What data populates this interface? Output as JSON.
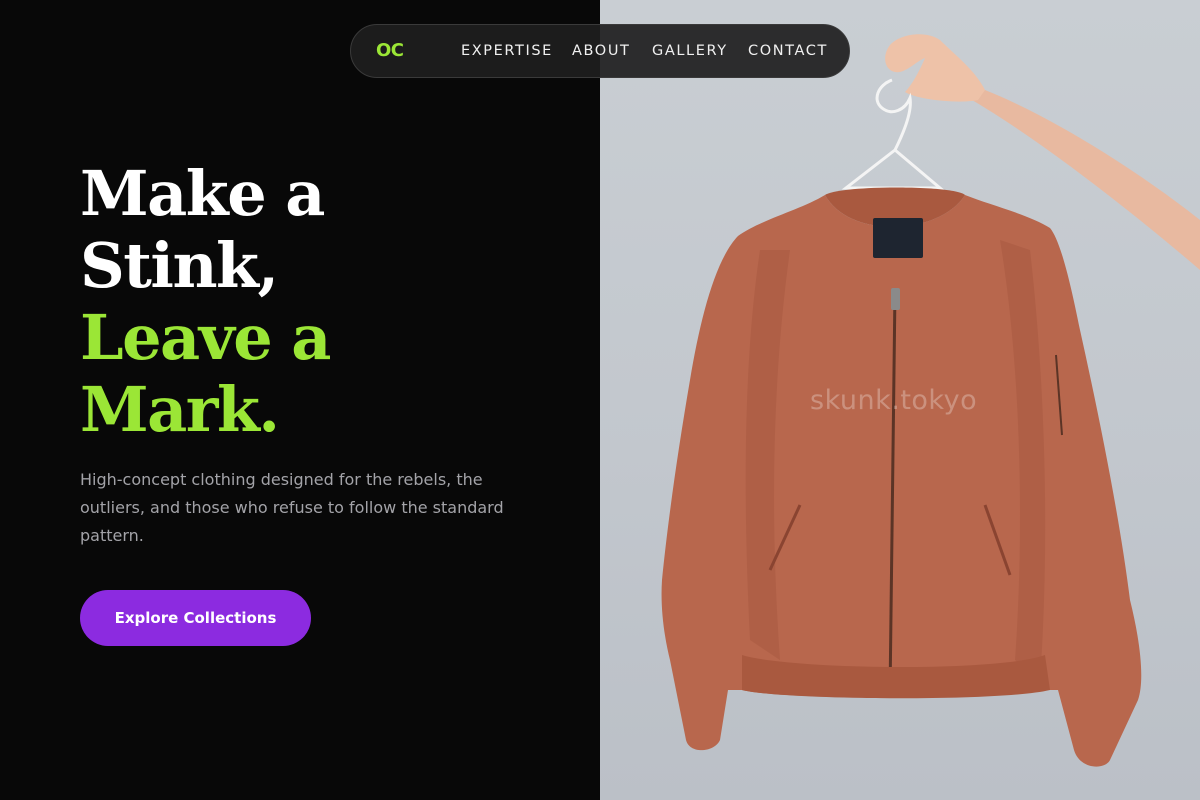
{
  "brand": {
    "logo": "OC",
    "accent_color": "#9be636"
  },
  "nav": {
    "items": [
      {
        "label": "EXPERTISE"
      },
      {
        "label": "ABOUT"
      },
      {
        "label": "GALLERY"
      },
      {
        "label": "CONTACT"
      }
    ]
  },
  "hero": {
    "headline": {
      "line1": "Make a",
      "line2": "Stink,",
      "line3": "Leave a",
      "line4": "Mark."
    },
    "subtitle": "High-concept clothing designed for the rebels, the outliers, and those who refuse to follow the standard pattern.",
    "cta_label": "Explore Collections",
    "cta_color": "#8c2be0"
  },
  "image": {
    "subject": "bomber-jacket-on-hanger",
    "watermark": "skunk.tokyo"
  }
}
